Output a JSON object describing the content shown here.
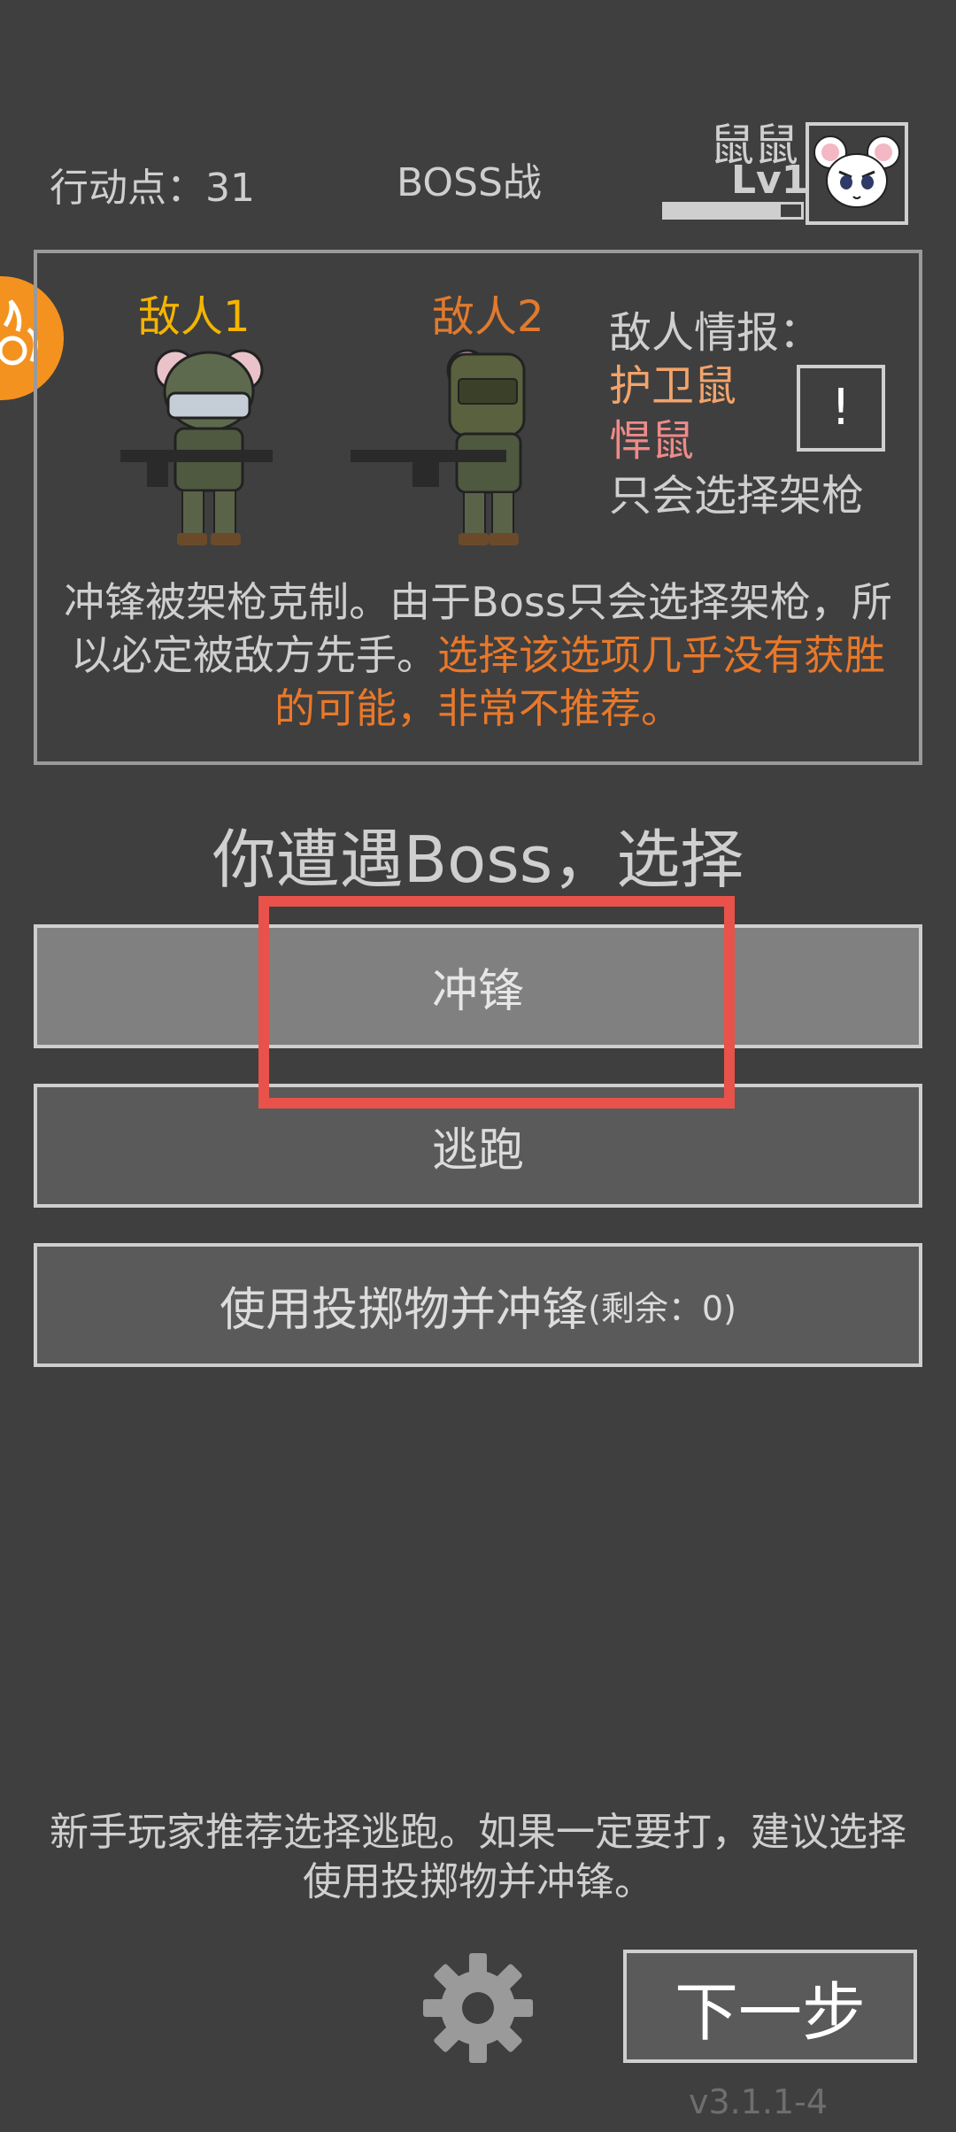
{
  "header": {
    "action_points": "行动点：31",
    "mode": "BOSS战",
    "player_name": "鼠鼠",
    "player_level": "Lv1",
    "exp_progress": 0.85
  },
  "panel": {
    "enemy1_label": "敌人1",
    "enemy2_label": "敌人2",
    "intel_title": "敌人情报：",
    "intel_enemy1": "护卫鼠",
    "intel_enemy2": "悍鼠",
    "intel_note": "只会选择架枪",
    "info_button": "!",
    "desc_normal": "冲锋被架枪克制。由于Boss只会选择架枪，所以必定被敌方先手。",
    "desc_warning": "选择该选项几乎没有获胜的可能，非常不推荐。"
  },
  "prompt": "你遭遇Boss，选择",
  "choices": {
    "charge": "冲锋",
    "flee": "逃跑",
    "throw_main": "使用投掷物并冲锋",
    "throw_remaining": "(剩余：0)"
  },
  "tip": "新手玩家推荐选择逃跑。如果一定要打，建议选择使用投掷物并冲锋。",
  "footer": {
    "next_label": "下一步",
    "version": "v3.1.1-4"
  },
  "colors": {
    "background": "#3f3f3f",
    "enemy1_label": "#f4b400",
    "enemy2_label": "#e07a2e",
    "warning": "#e8782a",
    "highlight": "#e8524a",
    "side_badge": "#f4921f"
  },
  "icons": {
    "settings": "gear-icon",
    "avatar": "mouse-avatar",
    "side_badge": "fire-emblem-icon"
  }
}
